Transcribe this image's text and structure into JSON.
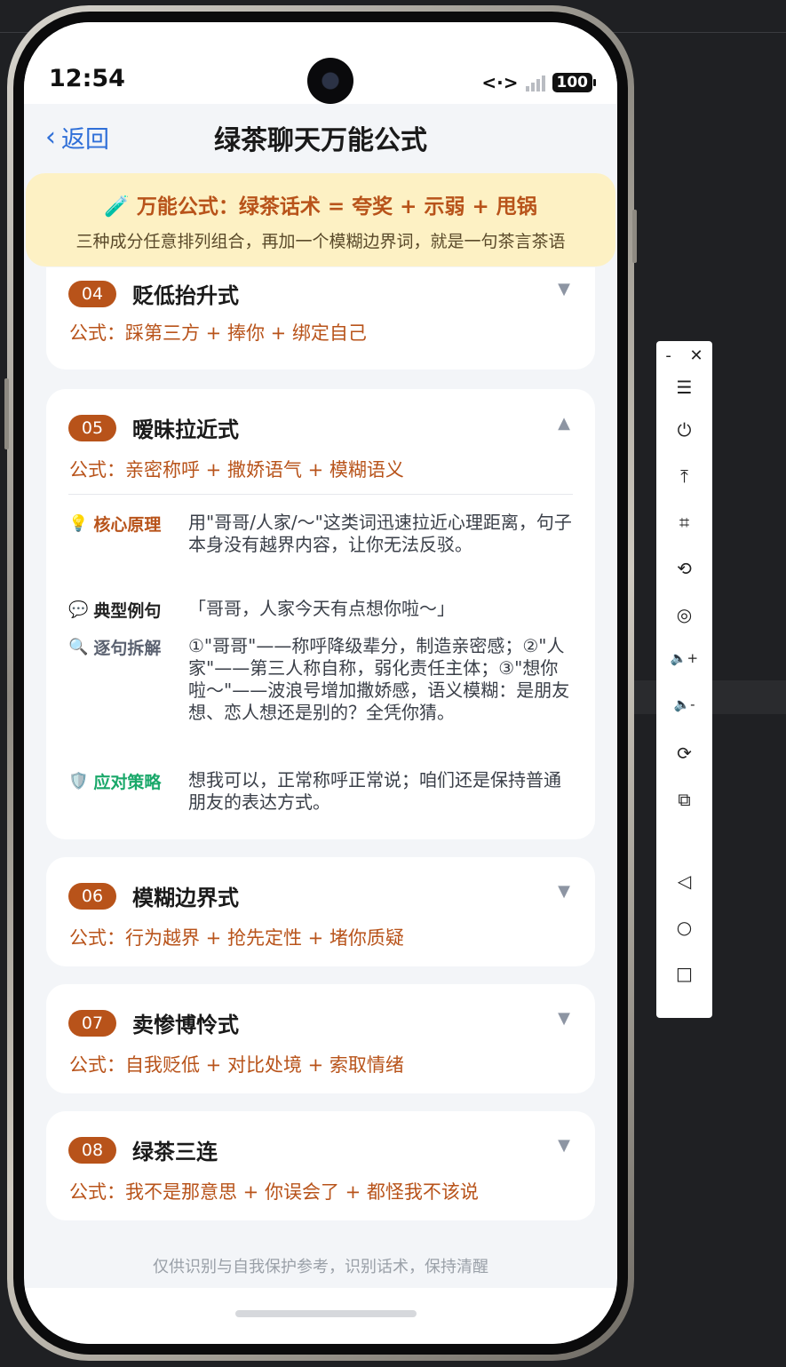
{
  "status": {
    "time": "12:54",
    "net": "<·>",
    "signal_mark": "x",
    "battery": "100"
  },
  "header": {
    "back_label": "返回",
    "title": "绿茶聊天万能公式"
  },
  "banner": {
    "title": "🧪 万能公式：绿茶话术 = 夸奖 + 示弱 + 甩锅",
    "subtitle": "三种成分任意排列组合，再加一个模糊边界词，就是一句茶言茶语"
  },
  "cards": [
    {
      "num": "04",
      "title": "贬低抬升式",
      "formula": "公式：踩第三方 + 捧你 + 绑定自己",
      "arrow": "▼"
    },
    {
      "num": "05",
      "title": "暧昧拉近式",
      "formula": "公式：亲密称呼 + 撒娇语气 + 模糊语义",
      "arrow": "▲",
      "details": [
        {
          "icon": "💡",
          "label": "核心原理",
          "text": "用\"哥哥/人家/～\"这类词迅速拉近心理距离，句子本身没有越界内容，让你无法反驳。"
        },
        {
          "icon": "💬",
          "label": "典型例句",
          "text": "「哥哥，人家今天有点想你啦～」"
        },
        {
          "icon": "🔍",
          "label": "逐句拆解",
          "text": "①\"哥哥\"——称呼降级辈分，制造亲密感；②\"人家\"——第三人称自称，弱化责任主体；③\"想你啦～\"——波浪号增加撒娇感，语义模糊：是朋友想、恋人想还是别的？全凭你猜。"
        },
        {
          "icon": "🛡️",
          "label": "应对策略",
          "text": "想我可以，正常称呼正常说；咱们还是保持普通朋友的表达方式。"
        }
      ]
    },
    {
      "num": "06",
      "title": "模糊边界式",
      "formula": "公式：行为越界 + 抢先定性 + 堵你质疑",
      "arrow": "▼"
    },
    {
      "num": "07",
      "title": "卖惨博怜式",
      "formula": "公式：自我贬低 + 对比处境 + 索取情绪",
      "arrow": "▼"
    },
    {
      "num": "08",
      "title": "绿茶三连",
      "formula": "公式：我不是那意思 + 你误会了 + 都怪我不该说",
      "arrow": "▼"
    }
  ],
  "footer": "仅供识别与自我保护参考，识别话术，保持清醒",
  "toolbar": {
    "minimize": "-",
    "close": "✕",
    "items": [
      "☰",
      "⏻",
      "⤒",
      "⌗",
      "⟲",
      "◎",
      "🔈+",
      "🔈-",
      "⟳",
      "⧉",
      "◁",
      "○",
      "□"
    ]
  },
  "colors": {
    "accent": "#b8531a",
    "link": "#2f6fd8",
    "banner_bg": "#fdf1c4",
    "green": "#1aa86a"
  }
}
